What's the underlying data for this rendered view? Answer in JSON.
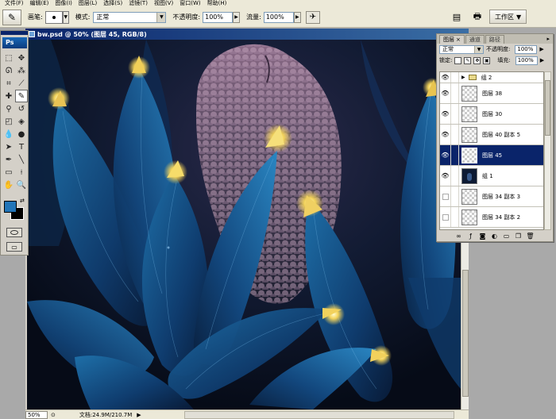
{
  "menubar": [
    "文件(F)",
    "编辑(E)",
    "图像(I)",
    "图层(L)",
    "选择(S)",
    "滤镜(T)",
    "视图(V)",
    "窗口(W)",
    "帮助(H)"
  ],
  "options": {
    "brush_label": "画笔:",
    "mode_label": "模式:",
    "mode_value": "正常",
    "opacity_label": "不透明度:",
    "opacity_value": "100%",
    "flow_label": "流量:",
    "flow_value": "100%",
    "workspace_label": "工作区"
  },
  "toolbox": {
    "logo": "Ps"
  },
  "document": {
    "title": "bw.psd @ 50% (图层 45, RGB/8)",
    "zoom": "50%",
    "status": "文档:24.9M/210.7M"
  },
  "layers_panel": {
    "tabs": [
      "图层",
      "通道",
      "路径"
    ],
    "blend_mode": "正常",
    "opacity_label": "不透明度:",
    "opacity_value": "100%",
    "lock_label": "锁定:",
    "fill_label": "填充:",
    "fill_value": "100%",
    "layers": [
      {
        "name": "组 2",
        "type": "group",
        "visible": true
      },
      {
        "name": "图层 38",
        "type": "layer",
        "visible": true
      },
      {
        "name": "图层 30",
        "type": "layer",
        "visible": true
      },
      {
        "name": "图层 40 副本 5",
        "type": "layer",
        "visible": true
      },
      {
        "name": "图层 45",
        "type": "layer",
        "visible": true,
        "selected": true
      },
      {
        "name": "组 1",
        "type": "layer-dark",
        "visible": true
      },
      {
        "name": "图层 34 副本 3",
        "type": "layer",
        "visible": false
      },
      {
        "name": "图层 34 副本 2",
        "type": "layer",
        "visible": false
      }
    ]
  },
  "colors": {
    "foreground": "#2275b8",
    "background": "#000000",
    "selection": "#0a246a"
  }
}
